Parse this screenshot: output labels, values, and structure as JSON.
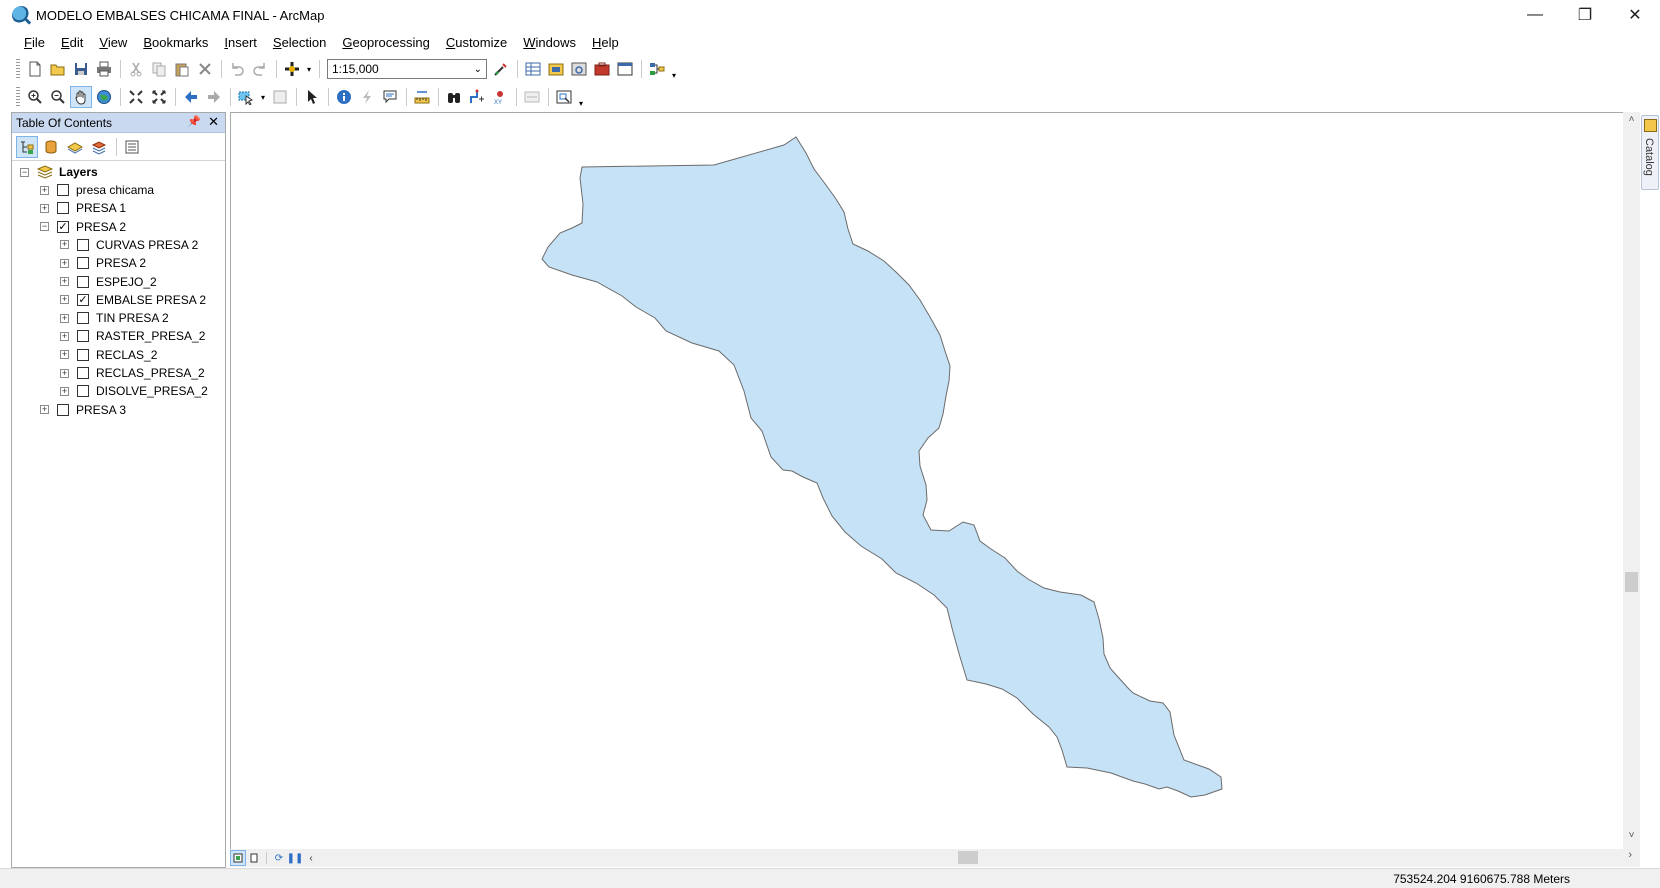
{
  "window": {
    "title": "MODELO EMBALSES CHICAMA FINAL - ArcMap",
    "minimize": "—",
    "restore": "❐",
    "close": "✕"
  },
  "menu": [
    {
      "pre": "",
      "u": "F",
      "post": "ile"
    },
    {
      "pre": "",
      "u": "E",
      "post": "dit"
    },
    {
      "pre": "",
      "u": "V",
      "post": "iew"
    },
    {
      "pre": "",
      "u": "B",
      "post": "ookmarks"
    },
    {
      "pre": "",
      "u": "I",
      "post": "nsert"
    },
    {
      "pre": "",
      "u": "S",
      "post": "election"
    },
    {
      "pre": "",
      "u": "G",
      "post": "eoprocessing"
    },
    {
      "pre": "",
      "u": "C",
      "post": "ustomize"
    },
    {
      "pre": "",
      "u": "W",
      "post": "indows"
    },
    {
      "pre": "",
      "u": "H",
      "post": "elp"
    }
  ],
  "toolbar": {
    "scale_value": "1:15,000"
  },
  "toc": {
    "title": "Table Of Contents",
    "pin": "📌",
    "close": "✕",
    "root_label": "Layers",
    "layers": [
      {
        "name": "presa chicama",
        "checked": false,
        "expanded": false,
        "level": 1
      },
      {
        "name": "PRESA 1",
        "checked": false,
        "expanded": false,
        "level": 1
      },
      {
        "name": "PRESA 2",
        "checked": true,
        "expanded": true,
        "level": 1
      },
      {
        "name": "CURVAS PRESA 2",
        "checked": false,
        "expanded": false,
        "level": 2
      },
      {
        "name": "PRESA 2",
        "checked": false,
        "expanded": false,
        "level": 2
      },
      {
        "name": "ESPEJO_2",
        "checked": false,
        "expanded": false,
        "level": 2
      },
      {
        "name": "EMBALSE PRESA 2",
        "checked": true,
        "expanded": false,
        "level": 2
      },
      {
        "name": "TIN PRESA 2",
        "checked": false,
        "expanded": false,
        "level": 2
      },
      {
        "name": "RASTER_PRESA_2",
        "checked": false,
        "expanded": false,
        "level": 2
      },
      {
        "name": "RECLAS_2",
        "checked": false,
        "expanded": false,
        "level": 2
      },
      {
        "name": "RECLAS_PRESA_2",
        "checked": false,
        "expanded": false,
        "level": 2
      },
      {
        "name": "DISOLVE_PRESA_2",
        "checked": false,
        "expanded": false,
        "level": 2
      },
      {
        "name": "PRESA 3",
        "checked": false,
        "expanded": false,
        "level": 1
      }
    ]
  },
  "map": {
    "polygon_fill": "#c6e2f7",
    "polygon_stroke": "#6b6b6b"
  },
  "catalog_tab": "Catalog",
  "status": {
    "coordinates": "753524.204  9160675.788 Meters"
  }
}
